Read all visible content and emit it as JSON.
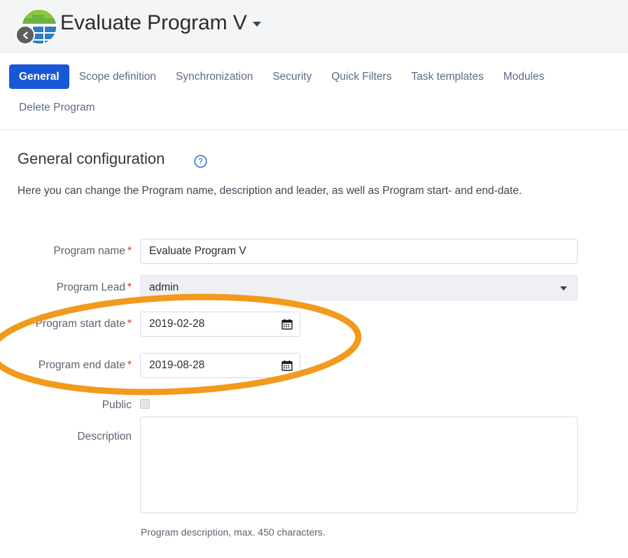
{
  "header": {
    "title": "Evaluate Program V",
    "logo_icon": "program-globe-logo",
    "back_icon": "chevron-left-icon",
    "caret_icon": "chevron-down-icon"
  },
  "tabs": {
    "row1": [
      {
        "label": "General",
        "active": true
      },
      {
        "label": "Scope definition",
        "active": false
      },
      {
        "label": "Synchronization",
        "active": false
      },
      {
        "label": "Security",
        "active": false
      },
      {
        "label": "Quick Filters",
        "active": false
      },
      {
        "label": "Task templates",
        "active": false
      },
      {
        "label": "Modules",
        "active": false
      }
    ],
    "row2": [
      {
        "label": "Delete Program",
        "active": false
      }
    ]
  },
  "section": {
    "title": "General configuration",
    "help_icon": "help-circle-icon",
    "description": "Here you can change the Program name, description and leader, as well as Program start- and end-date."
  },
  "form": {
    "program_name": {
      "label": "Program name",
      "required": "*",
      "value": "Evaluate Program V"
    },
    "program_lead": {
      "label": "Program Lead",
      "required": "*",
      "value": "admin",
      "caret_icon": "chevron-down-icon"
    },
    "start_date": {
      "label": "Program start date",
      "required": "*",
      "value": "2019-02-28",
      "icon": "calendar-icon"
    },
    "end_date": {
      "label": "Program end date",
      "required": "*",
      "value": "2019-08-28",
      "icon": "calendar-icon"
    },
    "public": {
      "label": "Public",
      "checked": false
    },
    "description": {
      "label": "Description",
      "value": "",
      "placeholder": "",
      "hint": "Program description, max. 450 characters."
    }
  },
  "annotation": {
    "shape": "ellipse-highlight",
    "color": "#F29A1D"
  },
  "colors": {
    "accent": "#1858d6",
    "required": "#c0392b",
    "annotation": "#F29A1D",
    "header_bg": "#f4f5f7"
  }
}
